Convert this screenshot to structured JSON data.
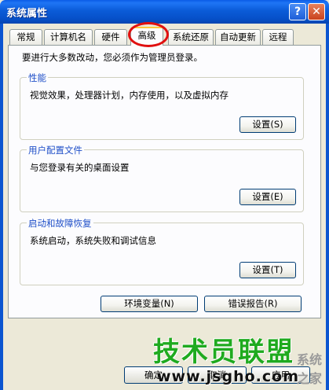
{
  "window": {
    "title": "系统属性",
    "help_glyph": "?",
    "close_glyph": "✕"
  },
  "tabs": [
    {
      "label": "常规",
      "active": false
    },
    {
      "label": "计算机名",
      "active": false
    },
    {
      "label": "硬件",
      "active": false
    },
    {
      "label": "高级",
      "active": true
    },
    {
      "label": "系统还原",
      "active": false
    },
    {
      "label": "自动更新",
      "active": false
    },
    {
      "label": "远程",
      "active": false
    }
  ],
  "intro_text": "要进行大多数改动，您必须作为管理员登录。",
  "groups": {
    "performance": {
      "title": "性能",
      "description": "视觉效果，处理器计划，内存使用，以及虚拟内存",
      "button": "设置(S)"
    },
    "user_profiles": {
      "title": "用户配置文件",
      "description": "与您登录有关的桌面设置",
      "button": "设置(E)"
    },
    "startup_recovery": {
      "title": "启动和故障恢复",
      "description": "系统启动，系统失败和调试信息",
      "button": "设置(T)"
    }
  },
  "actions": {
    "env_vars": "环境变量(N)",
    "error_report": "错误报告(R)"
  },
  "dialog_buttons": {
    "ok": "确定",
    "cancel": "取消",
    "apply": "应用"
  },
  "watermark": {
    "site_name": "技术员联盟",
    "small_text": "系统之家",
    "url": "www.jsgho.com"
  },
  "colors": {
    "title_bar": "#0b5bd8",
    "group_title": "#1f4fc8",
    "highlight_circle": "#e01010",
    "watermark": "#1faa1f"
  }
}
